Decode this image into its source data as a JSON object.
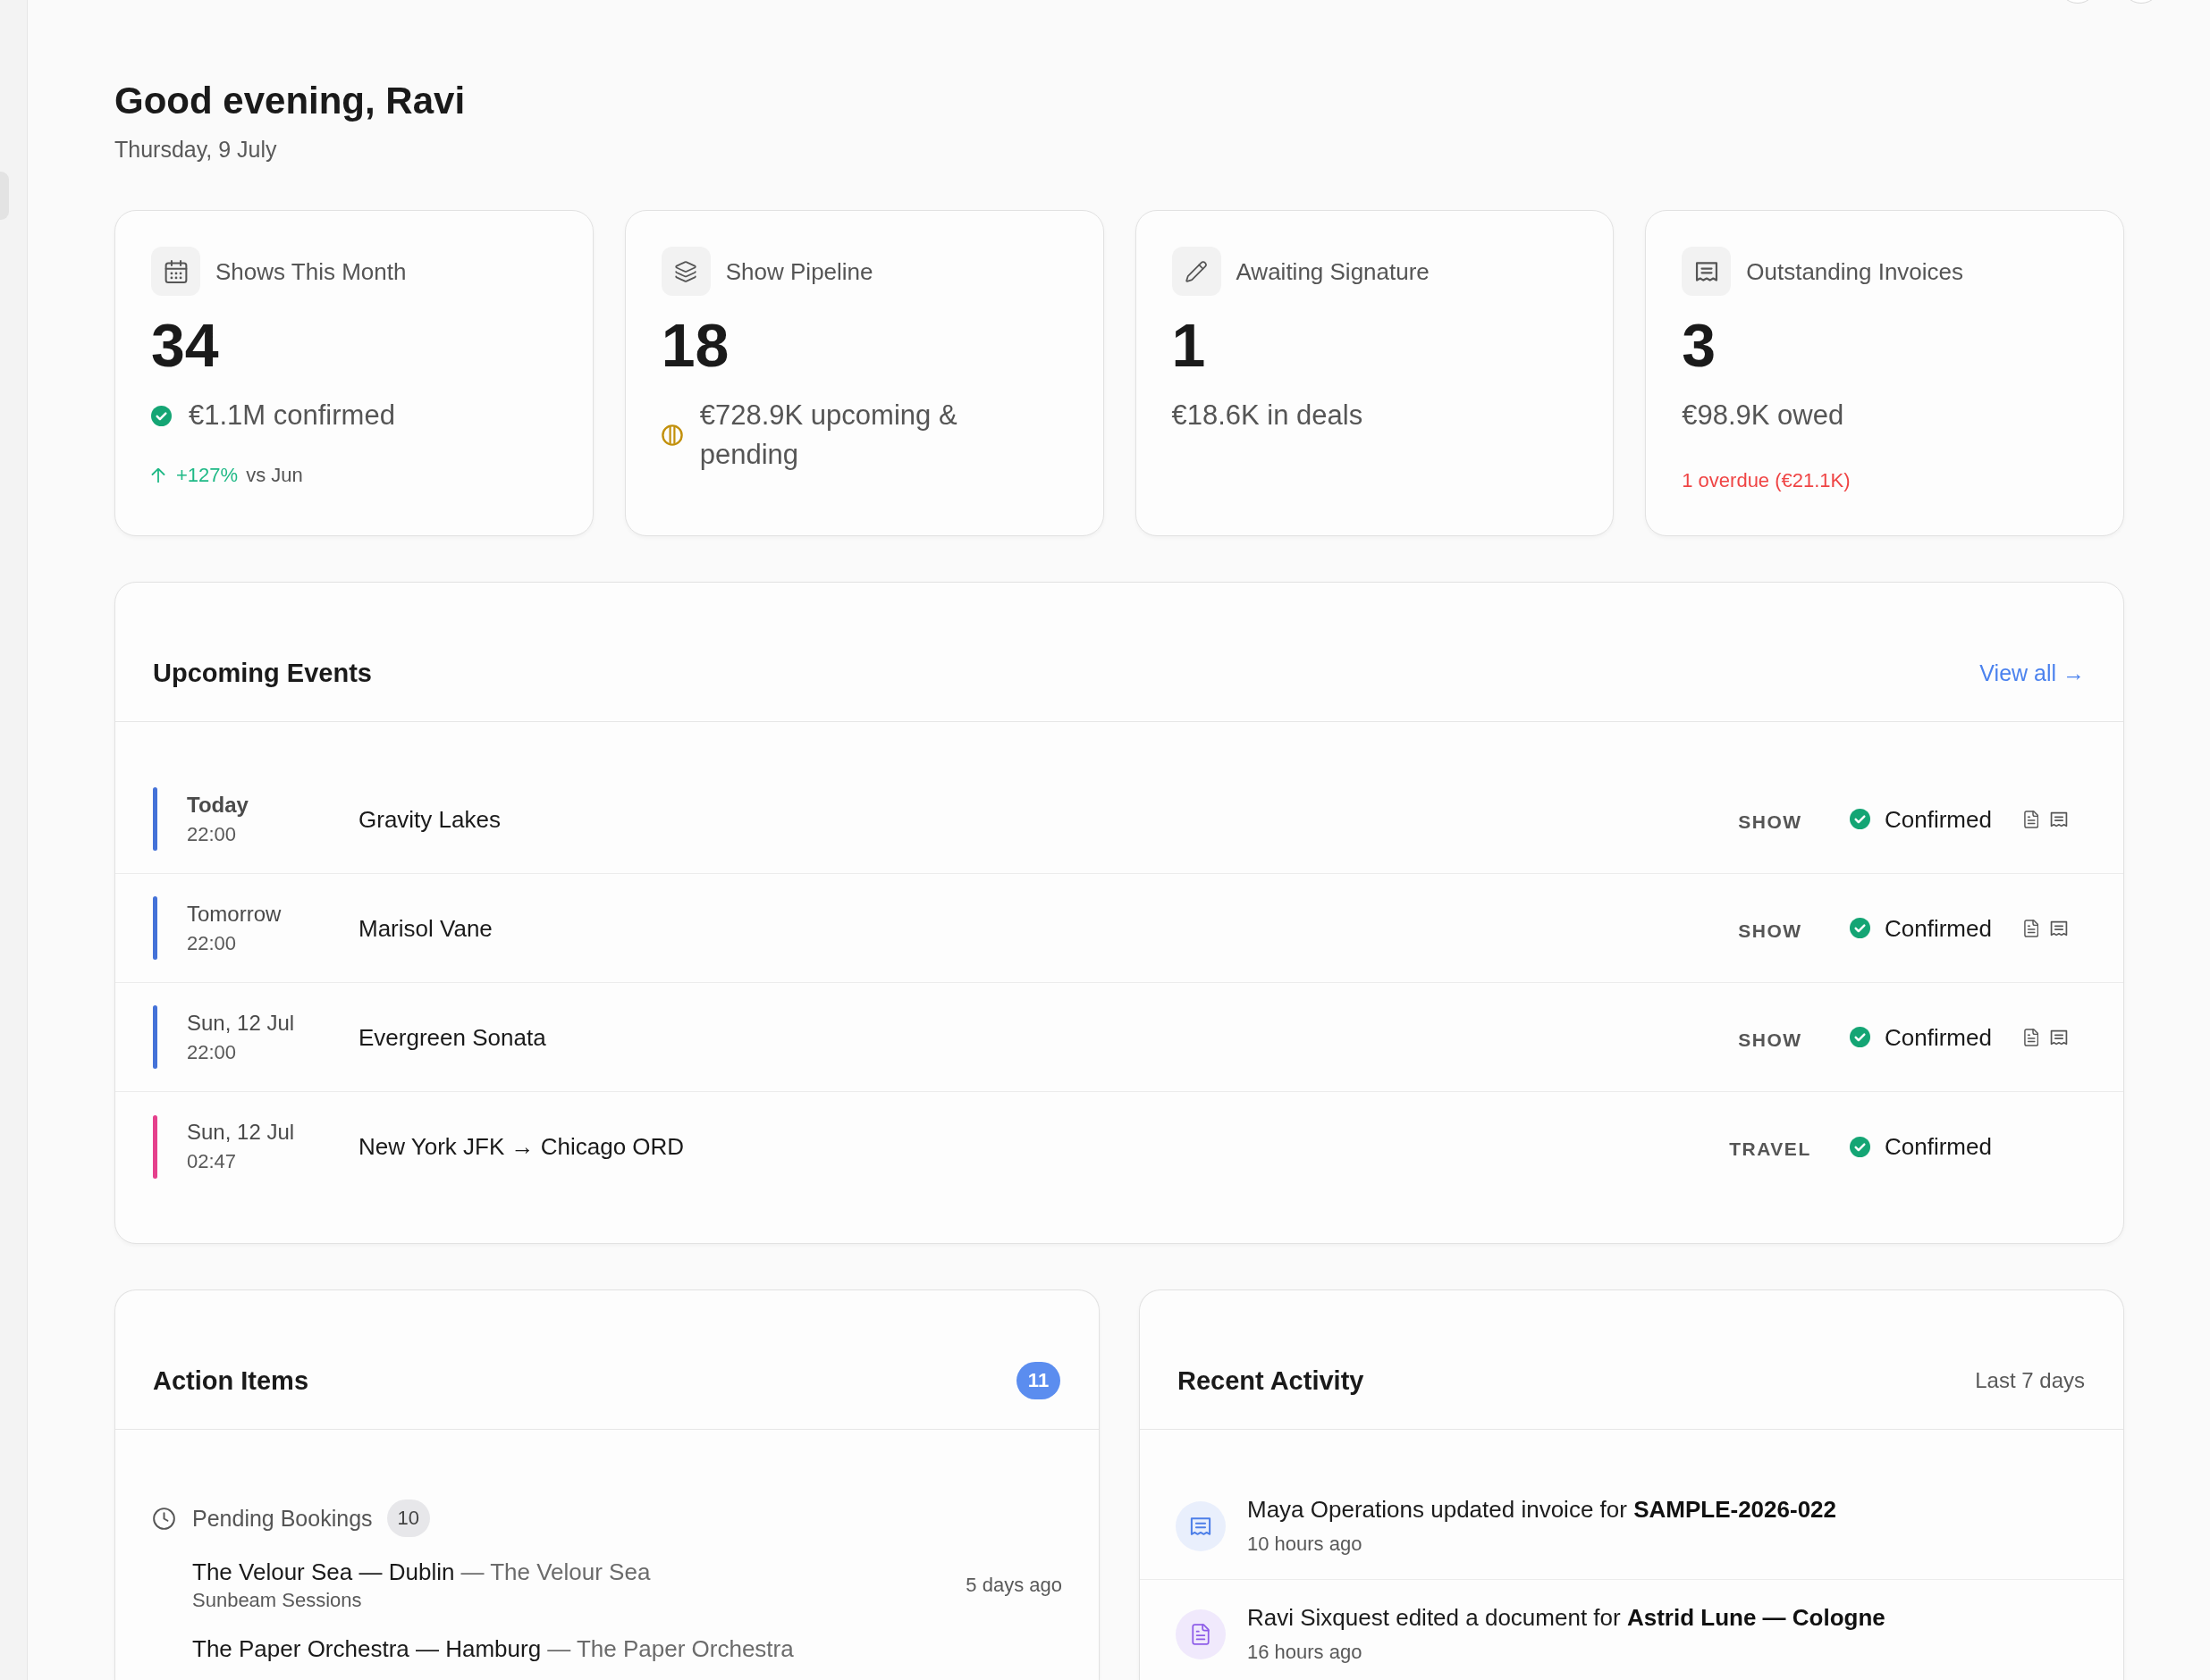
{
  "greeting": {
    "title": "Good evening, Ravi",
    "date": "Thursday, 9 July"
  },
  "stat_cards": [
    {
      "label": "Shows This Month",
      "value": "34",
      "summary": {
        "kind": "confirmed",
        "text": "€1.1M confirmed"
      },
      "footnote": {
        "kind": "trend",
        "change": "+127%",
        "text": "vs Jun"
      }
    },
    {
      "label": "Show Pipeline",
      "value": "18",
      "summary": {
        "kind": "pending",
        "text": "€728.9K upcoming & pending"
      }
    },
    {
      "label": "Awaiting Signature",
      "value": "1",
      "summary": {
        "kind": "plain",
        "text": "€18.6K in deals"
      }
    },
    {
      "label": "Outstanding Invoices",
      "value": "3",
      "summary": {
        "kind": "plain",
        "text": "€98.9K owed"
      },
      "footnote": {
        "kind": "alert",
        "text": "1 overdue (€21.1K)"
      }
    }
  ],
  "upcoming_events": {
    "title": "Upcoming Events",
    "link": "View all →",
    "events": [
      {
        "date": "Today",
        "today": true,
        "time": "22:00",
        "title": "Gravity Lakes",
        "type": "SHOW",
        "color": "#4472d8",
        "status": {
          "kind": "confirmed",
          "text": "Confirmed"
        },
        "documents": true
      },
      {
        "date": "Tomorrow",
        "today": false,
        "time": "22:00",
        "title": "Marisol Vane",
        "type": "SHOW",
        "color": "#4472d8",
        "status": {
          "kind": "confirmed",
          "text": "Confirmed"
        },
        "documents": true
      },
      {
        "date": "Sun, 12 Jul",
        "today": false,
        "time": "22:00",
        "title": "Evergreen Sonata",
        "type": "SHOW",
        "color": "#4472d8",
        "status": {
          "kind": "confirmed",
          "text": "Confirmed"
        },
        "documents": true
      },
      {
        "date": "Sun, 12 Jul",
        "today": false,
        "time": "02:47",
        "title": "New York JFK → Chicago ORD",
        "type": "TRAVEL",
        "color": "#e5408c",
        "status": {
          "kind": "confirmed",
          "text": "Confirmed"
        },
        "documents": false
      }
    ]
  },
  "action_items": {
    "title": "Action Items",
    "count": "11",
    "groups": [
      {
        "label": "Pending Bookings",
        "count": "10",
        "items": [
          {
            "title": "The Velour Sea — Dublin",
            "context": "— The Velour Sea",
            "subtitle": "Sunbeam Sessions",
            "time": "5 days ago"
          },
          {
            "title": "The Paper Orchestra — Hamburg",
            "context": "— The Paper Orchestra"
          }
        ]
      }
    ]
  },
  "recent_activity": {
    "title": "Recent Activity",
    "range": "Last 7 days",
    "items": [
      {
        "kind": "invoice",
        "text": "Maya Operations updated invoice for **SAMPLE-2026-022**",
        "time": "10 hours ago"
      },
      {
        "kind": "document",
        "text": "Ravi Sixquest edited a document for **Astrid Lune — Cologne**",
        "time": "16 hours ago"
      }
    ]
  }
}
